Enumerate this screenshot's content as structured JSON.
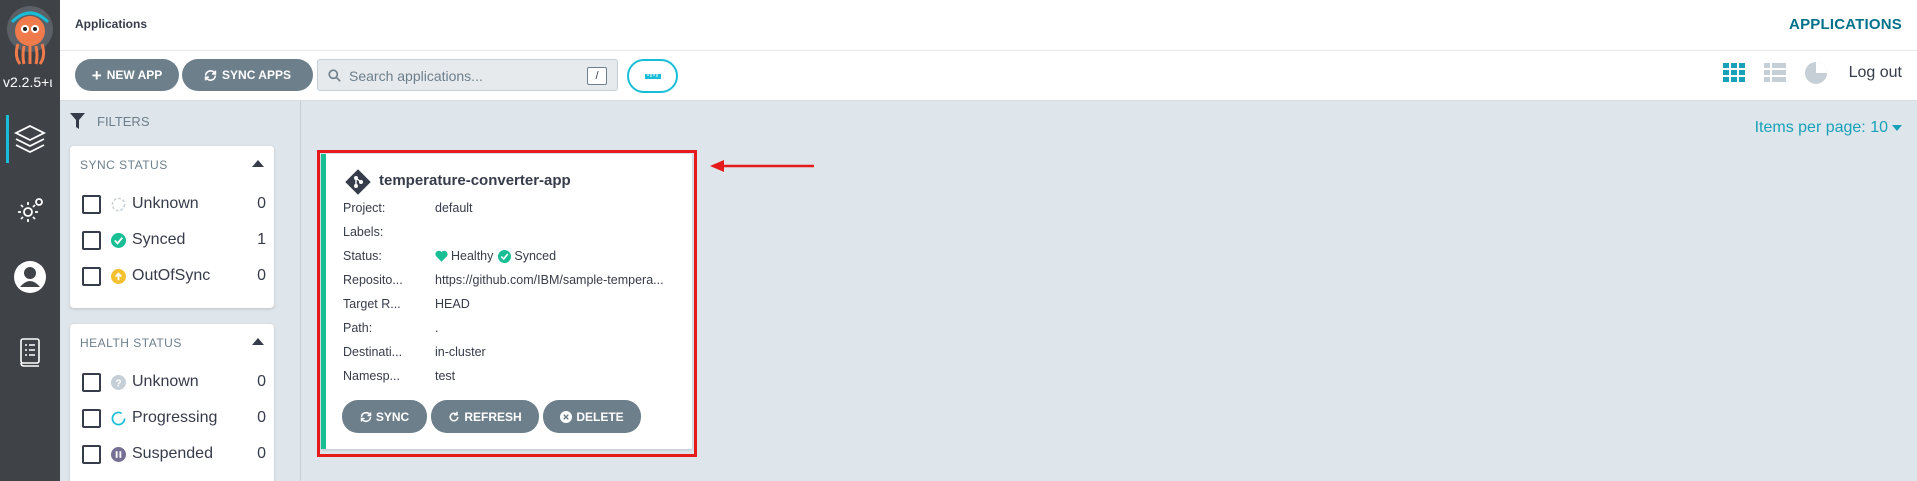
{
  "nav": {
    "version": "v2.2.5+ι",
    "items": [
      {
        "icon": "layers-icon",
        "active": true
      },
      {
        "icon": "gear-icon",
        "active": false
      },
      {
        "icon": "user-icon",
        "active": false
      },
      {
        "icon": "docs-icon",
        "active": false
      }
    ]
  },
  "topbar": {
    "breadcrumb": "Applications",
    "title": "APPLICATIONS"
  },
  "toolbar": {
    "new_app": "NEW APP",
    "sync_apps": "SYNC APPS",
    "search_placeholder": "Search applications...",
    "search_key": "/",
    "logout": "Log out",
    "views": [
      "tiles-view-icon",
      "list-view-icon",
      "summary-pie-icon"
    ]
  },
  "filters": {
    "heading": "FILTERS",
    "sync_status": {
      "title": "SYNC STATUS",
      "items": [
        {
          "label": "Unknown",
          "count": "0",
          "icon": "unknown-circle-icon"
        },
        {
          "label": "Synced",
          "count": "1",
          "icon": "check-circle-icon"
        },
        {
          "label": "OutOfSync",
          "count": "0",
          "icon": "arrow-up-circle-icon"
        }
      ]
    },
    "health_status": {
      "title": "HEALTH STATUS",
      "items": [
        {
          "label": "Unknown",
          "count": "0",
          "icon": "question-circle-icon"
        },
        {
          "label": "Progressing",
          "count": "0",
          "icon": "spinner-icon"
        },
        {
          "label": "Suspended",
          "count": "0",
          "icon": "pause-circle-icon"
        }
      ]
    }
  },
  "main": {
    "items_per_page": "Items per page: 10",
    "app_card": {
      "name": "temperature-converter-app",
      "rows": [
        {
          "key": "Project:",
          "value": "default"
        },
        {
          "key": "Labels:",
          "value": ""
        },
        {
          "key": "Status:",
          "health": "Healthy",
          "sync": "Synced"
        },
        {
          "key": "Reposito...",
          "value": "https://github.com/IBM/sample-tempera..."
        },
        {
          "key": "Target R...",
          "value": "HEAD"
        },
        {
          "key": "Path:",
          "value": "."
        },
        {
          "key": "Destinati...",
          "value": "in-cluster"
        },
        {
          "key": "Namesp...",
          "value": "test"
        }
      ],
      "buttons": {
        "sync": "SYNC",
        "refresh": "REFRESH",
        "delete": "DELETE"
      }
    }
  },
  "colors": {
    "accent": "#18bed8",
    "healthy": "#18be94",
    "highlight": "#e51b1b",
    "out_of_sync": "#f4c030"
  }
}
